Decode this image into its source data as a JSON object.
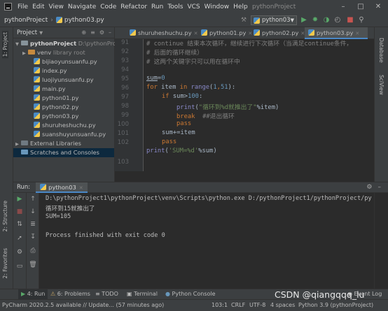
{
  "menubar": {
    "items": [
      "File",
      "Edit",
      "View",
      "Navigate",
      "Code",
      "Refactor",
      "Run",
      "Tools",
      "VCS",
      "Window",
      "Help"
    ],
    "window_title": "pythonProject"
  },
  "navbar": {
    "project": "pythonProject",
    "file": "python03.py",
    "run_config": "python03"
  },
  "left_stripe": {
    "project_tab": "1: Project",
    "structure_tab": "2: Structure",
    "favorites_tab": "2: Favorites"
  },
  "right_stripe": {
    "database_tab": "Database",
    "sciview_tab": "SciView"
  },
  "project_panel": {
    "title": "Project",
    "tree": [
      {
        "label": "pythonProject",
        "extra": "D:\\pythonProje"
      },
      {
        "label": "venv",
        "extra": "library root"
      },
      {
        "label": "bijiaoyunsuanfu.py"
      },
      {
        "label": "index.py"
      },
      {
        "label": "luojiyunsuanfu.py"
      },
      {
        "label": "main.py"
      },
      {
        "label": "python01.py"
      },
      {
        "label": "python02.py"
      },
      {
        "label": "python03.py"
      },
      {
        "label": "shuruheshuchu.py"
      },
      {
        "label": "suanshuyunsuanfu.py"
      },
      {
        "label": "External Libraries"
      },
      {
        "label": "Scratches and Consoles"
      }
    ]
  },
  "editor": {
    "tabs": [
      "shuruheshuchu.py",
      "python01.py",
      "python02.py",
      "python03.py"
    ],
    "active_tab": "python03.py",
    "line_numbers": [
      "91",
      "92",
      "93",
      "94",
      "95",
      "96",
      "97",
      "98",
      "99",
      "100",
      "101",
      "102",
      "103"
    ],
    "code": {
      "l91": "# continue 结束本次循环，继续进行下次循环（当满足continue条件，",
      "l92": "# 后面的循环继续）",
      "l93": "# 这两个关键字只可以用在循环中",
      "l95_var": "sum",
      "l95_rest": "=",
      "l95_num": "0",
      "l96_a": "for",
      "l96_b": " item ",
      "l96_c": "in",
      "l96_d": " ",
      "l96_e": "range",
      "l96_f": "(",
      "l96_g": "1",
      "l96_h": ",",
      "l96_i": "51",
      "l96_j": "):",
      "l97_a": "if",
      "l97_b": " sum>",
      "l97_c": "100",
      "l97_d": ":",
      "l98_a": "print",
      "l98_b": "(",
      "l98_c": "\"循环到%d就推出了\"",
      "l98_d": "%item)",
      "l99_a": "break",
      "l99_b": "  ##退出循环",
      "l100_a": "pass",
      "l101": "sum+=item",
      "l102_a": "pass",
      "l103_a": "print",
      "l103_b": "(",
      "l103_c": "'SUM=%d'",
      "l103_d": "%sum)"
    }
  },
  "run": {
    "label": "Run:",
    "tab": "python03",
    "output": [
      "D:\\pythonProject1\\pythonProject\\venv\\Scripts\\python.exe D:/pythonProject1/pythonProject/py",
      "循环到15就推出了",
      "SUM=105",
      "",
      "Process finished with exit code 0"
    ]
  },
  "bottom_tabs": [
    "4: Run",
    "6: Problems",
    "TODO",
    "Terminal",
    "Python Console",
    "Event Log"
  ],
  "status": {
    "message": "PyCharm 2020.2.5 available // Update... (57 minutes ago)",
    "position": "103:1",
    "line_sep": "CRLF",
    "encoding": "UTF-8",
    "indent": "4 spaces",
    "interpreter": "Python 3.9 (pythonProject)"
  },
  "watermark": "CSDN @qiangqqq_lu",
  "colors": {
    "accent": "#4a88c7",
    "keyword": "#cc7832",
    "string": "#6a8759",
    "number": "#6897bb",
    "builtin": "#8888c6",
    "run_green": "#59a869"
  }
}
